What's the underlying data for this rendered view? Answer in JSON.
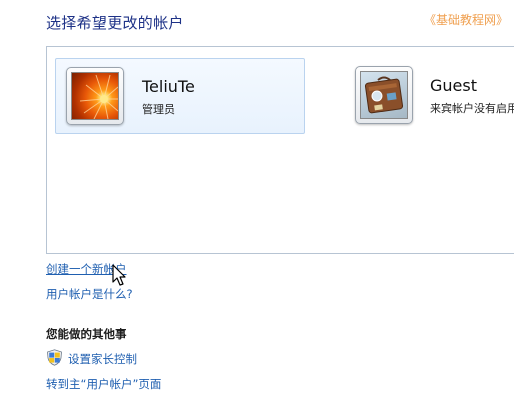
{
  "page": {
    "title": "选择希望更改的帐户",
    "watermark": "《基础教程网》"
  },
  "accounts": [
    {
      "name": "TeliuTe",
      "role": "管理员",
      "avatar": "flower-avatar",
      "selected": true
    },
    {
      "name": "Guest",
      "role": "来宾帐户没有启用",
      "avatar": "suitcase-avatar",
      "selected": false
    }
  ],
  "links": {
    "create_account": "创建一个新帐户",
    "what_is_account": "用户帐户是什么?"
  },
  "other_section": {
    "heading": "您能做的其他事",
    "parental_controls": "设置家长控制",
    "go_main": "转到主“用户帐户”页面"
  },
  "icons": {
    "parental": "windows-shield-icon",
    "cursor": "arrow-cursor-icon"
  }
}
